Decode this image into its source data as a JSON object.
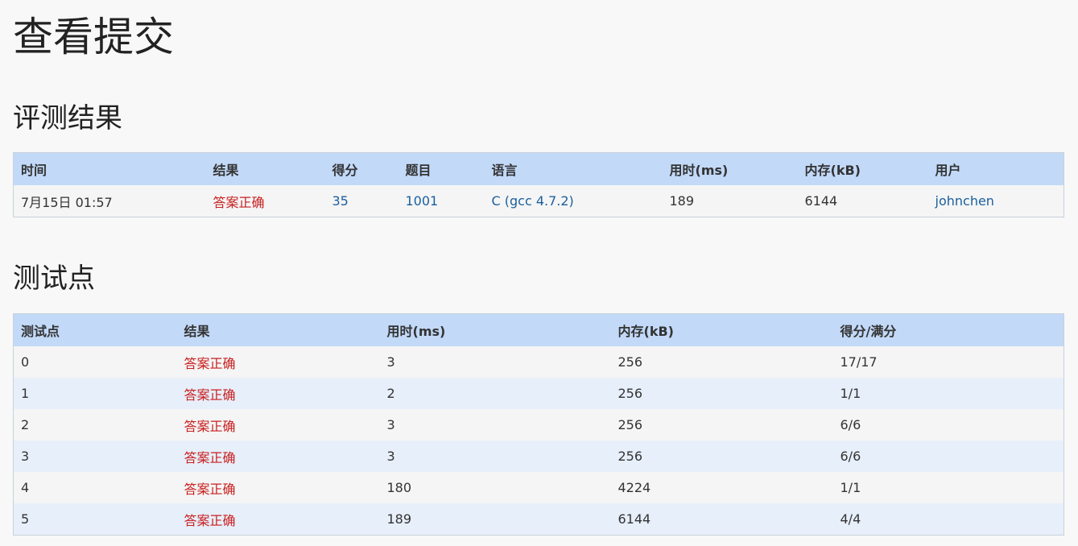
{
  "page_title": "查看提交",
  "judge_section": {
    "title": "评测结果",
    "headers": [
      "时间",
      "结果",
      "得分",
      "题目",
      "语言",
      "用时(ms)",
      "内存(kB)",
      "用户"
    ],
    "row": {
      "time": "7月15日 01:57",
      "result": "答案正确",
      "score": "35",
      "problem": "1001",
      "language": "C (gcc 4.7.2)",
      "time_ms": "189",
      "memory_kb": "6144",
      "user": "johnchen"
    }
  },
  "tests_section": {
    "title": "测试点",
    "headers": [
      "测试点",
      "结果",
      "用时(ms)",
      "内存(kB)",
      "得分/满分"
    ],
    "rows": [
      {
        "id": "0",
        "result": "答案正确",
        "time_ms": "3",
        "memory_kb": "256",
        "score": "17/17"
      },
      {
        "id": "1",
        "result": "答案正确",
        "time_ms": "2",
        "memory_kb": "256",
        "score": "1/1"
      },
      {
        "id": "2",
        "result": "答案正确",
        "time_ms": "3",
        "memory_kb": "256",
        "score": "6/6"
      },
      {
        "id": "3",
        "result": "答案正确",
        "time_ms": "3",
        "memory_kb": "256",
        "score": "6/6"
      },
      {
        "id": "4",
        "result": "答案正确",
        "time_ms": "180",
        "memory_kb": "4224",
        "score": "1/1"
      },
      {
        "id": "5",
        "result": "答案正确",
        "time_ms": "189",
        "memory_kb": "6144",
        "score": "4/4"
      }
    ]
  },
  "colors": {
    "header_bg": "#c2d9f8",
    "accepted": "#c81e1e",
    "link": "#1a5f9e"
  }
}
